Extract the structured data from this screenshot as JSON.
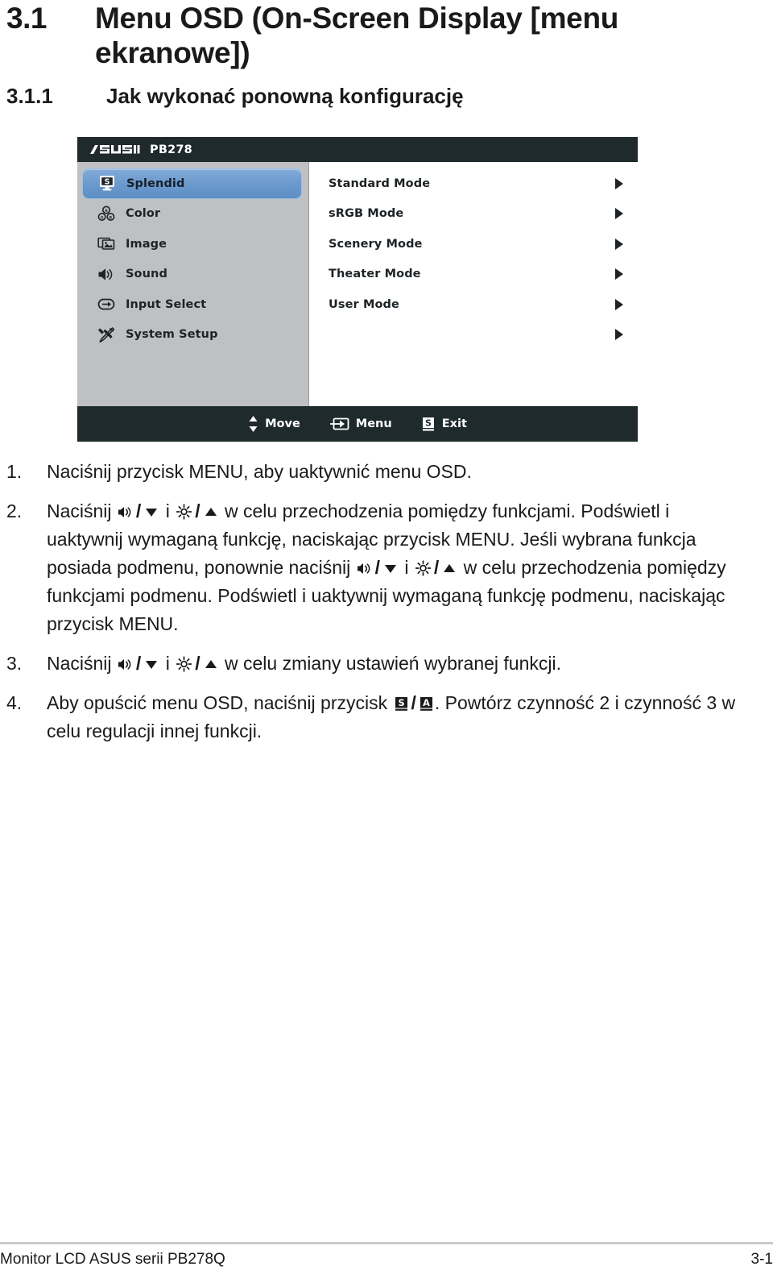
{
  "headings": {
    "section_number": "3.1",
    "section_title": "Menu OSD (On-Screen Display [menu ekranowe])",
    "subsection_number": "3.1.1",
    "subsection_title": "Jak wykonać ponowną konfigurację"
  },
  "osd": {
    "brand": "ASUS",
    "model": "PB278",
    "title_bar_color": "#1e2a2c",
    "sidebar_color": "#bec0c3",
    "highlight_color": "#6b9acd",
    "sidebar": [
      {
        "label": "Splendid",
        "icon": "splendid-monitor-icon",
        "selected": true
      },
      {
        "label": "Color",
        "icon": "color-rgb-icon",
        "selected": false
      },
      {
        "label": "Image",
        "icon": "image-frames-icon",
        "selected": false
      },
      {
        "label": "Sound",
        "icon": "speaker-icon",
        "selected": false
      },
      {
        "label": "Input Select",
        "icon": "input-arrow-icon",
        "selected": false
      },
      {
        "label": "System Setup",
        "icon": "tools-wrench-icon",
        "selected": false
      }
    ],
    "modes": [
      {
        "label": "Standard Mode",
        "arrow": true
      },
      {
        "label": "sRGB Mode",
        "arrow": true
      },
      {
        "label": "Scenery Mode",
        "arrow": true
      },
      {
        "label": "Theater Mode",
        "arrow": true
      },
      {
        "label": "User Mode",
        "arrow": true
      },
      {
        "label": "",
        "arrow": true
      }
    ],
    "footer": [
      {
        "label": "Move",
        "icon": "up-down-arrows-icon"
      },
      {
        "label": "Menu",
        "icon": "enter-menu-icon"
      },
      {
        "label": "Exit",
        "icon": "s-key-icon"
      }
    ]
  },
  "steps": [
    {
      "number": "1.",
      "parts": [
        {
          "t": "text",
          "v": "Naciśnij przycisk MENU, aby uaktywnić menu OSD."
        }
      ]
    },
    {
      "number": "2.",
      "parts": [
        {
          "t": "text",
          "v": "Naciśnij "
        },
        {
          "t": "icon",
          "v": "speaker-down-icon"
        },
        {
          "t": "sep",
          "v": "/"
        },
        {
          "t": "icon",
          "v": "triangle-down-icon"
        },
        {
          "t": "text",
          "v": " i "
        },
        {
          "t": "icon",
          "v": "brightness-sun-icon"
        },
        {
          "t": "sep",
          "v": "/"
        },
        {
          "t": "icon",
          "v": "triangle-up-icon"
        },
        {
          "t": "text",
          "v": " w celu przechodzenia pomiędzy funkcjami. Podświetl i uaktywnij wymaganą funkcję, naciskając przycisk MENU. Jeśli wybrana funkcja posiada podmenu, ponownie naciśnij "
        },
        {
          "t": "icon",
          "v": "speaker-down-icon"
        },
        {
          "t": "sep",
          "v": "/"
        },
        {
          "t": "icon",
          "v": "triangle-down-icon"
        },
        {
          "t": "text",
          "v": " i "
        },
        {
          "t": "icon",
          "v": "brightness-sun-icon"
        },
        {
          "t": "sep",
          "v": "/"
        },
        {
          "t": "icon",
          "v": "triangle-up-icon"
        },
        {
          "t": "text",
          "v": " w celu przechodzenia pomiędzy funkcjami podmenu. Podświetl i uaktywnij wymaganą funkcję podmenu, naciskając przycisk MENU."
        }
      ]
    },
    {
      "number": "3.",
      "parts": [
        {
          "t": "text",
          "v": "Naciśnij "
        },
        {
          "t": "icon",
          "v": "speaker-down-icon"
        },
        {
          "t": "sep",
          "v": "/"
        },
        {
          "t": "icon",
          "v": "triangle-down-icon"
        },
        {
          "t": "text",
          "v": " i "
        },
        {
          "t": "icon",
          "v": "brightness-sun-icon"
        },
        {
          "t": "sep",
          "v": "/"
        },
        {
          "t": "icon",
          "v": "triangle-up-icon"
        },
        {
          "t": "text",
          "v": " w celu zmiany ustawień wybranej funkcji."
        }
      ]
    },
    {
      "number": "4.",
      "parts": [
        {
          "t": "text",
          "v": "Aby opuścić menu OSD, naciśnij przycisk "
        },
        {
          "t": "icon",
          "v": "s-key-icon"
        },
        {
          "t": "sep",
          "v": "/"
        },
        {
          "t": "icon",
          "v": "a-key-icon"
        },
        {
          "t": "text",
          "v": ". Powtórz czynność 2 i czynność 3 w celu regulacji innej funkcji."
        }
      ]
    }
  ],
  "page_footer": {
    "left": "Monitor LCD ASUS serii PB278Q",
    "right": "3-1"
  }
}
